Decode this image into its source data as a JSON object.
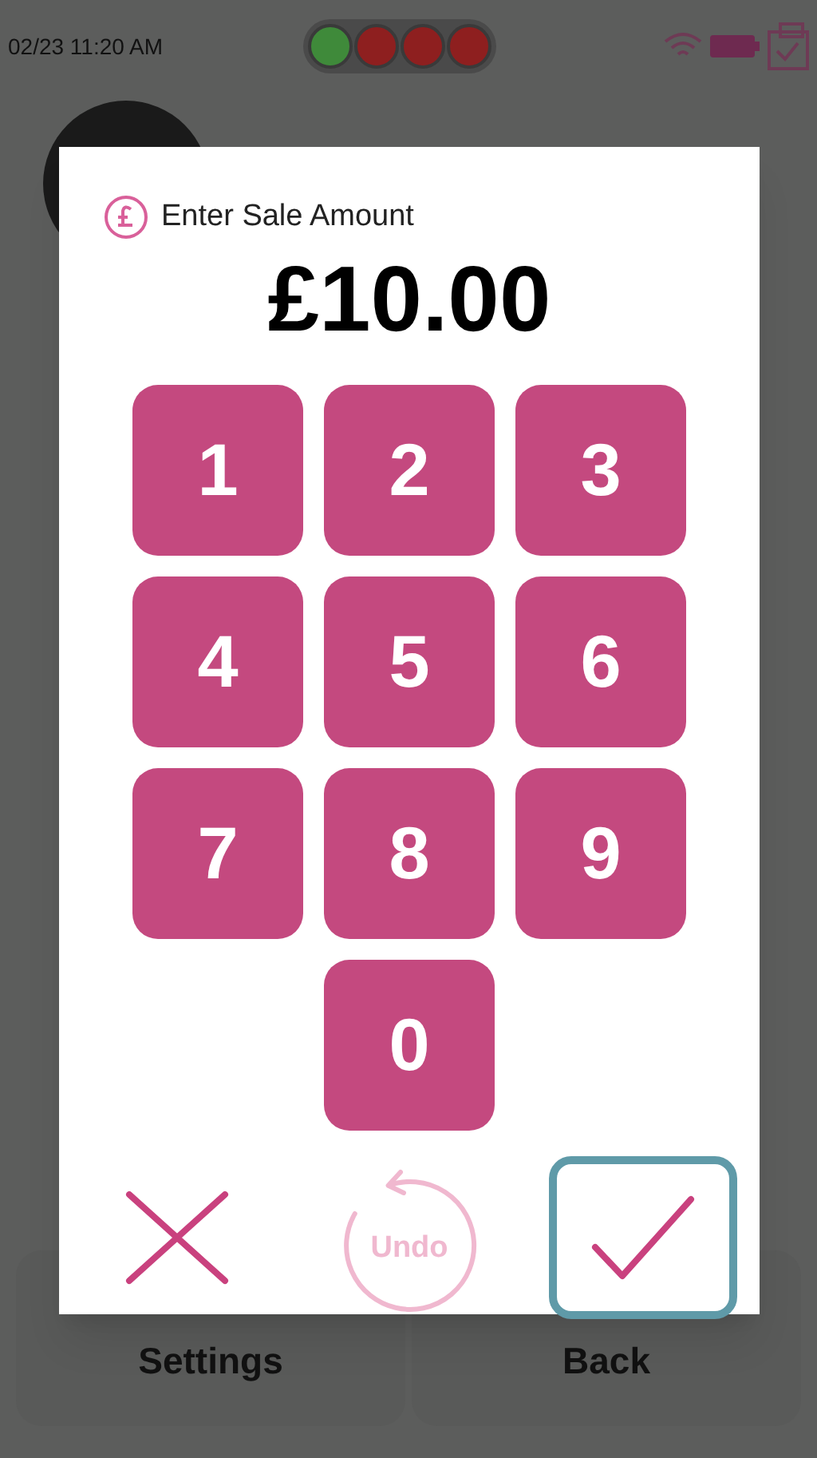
{
  "status_bar": {
    "datetime": "02/23 11:20 AM",
    "leds": [
      {
        "color": "#3f8a3a"
      },
      {
        "color": "#8e1f1f"
      },
      {
        "color": "#8e1f1f"
      },
      {
        "color": "#8e1f1f"
      }
    ]
  },
  "dialog": {
    "title": "Enter Sale Amount",
    "amount": "£10.00",
    "keys": [
      "1",
      "2",
      "3",
      "4",
      "5",
      "6",
      "7",
      "8",
      "9",
      "0"
    ],
    "actions": [
      {
        "kind": "cancel",
        "focused": false,
        "disabled": false
      },
      {
        "kind": "undo",
        "label": "Undo",
        "focused": false,
        "disabled": true
      },
      {
        "kind": "confirm",
        "focused": true,
        "disabled": false
      }
    ]
  },
  "bottom_buttons": [
    "Settings",
    "Back"
  ]
}
